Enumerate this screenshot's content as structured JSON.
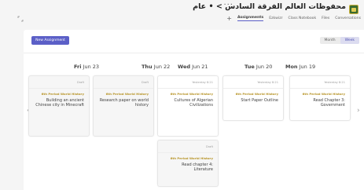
{
  "header": {
    "channel_title": "محفوظات العالم الفرقة السادس > • عام",
    "tabs": [
      {
        "label": "Conversations",
        "active": false
      },
      {
        "label": "Files",
        "active": false
      },
      {
        "label": "Class Notebook",
        "active": false
      },
      {
        "label": "Ezkwizr",
        "active": false
      },
      {
        "label": "Assignments",
        "active": true
      }
    ],
    "add_tab": "+",
    "more": "···"
  },
  "toolbar": {
    "new_assignment_label": "New Assignment",
    "view_toggle": [
      {
        "label": "Week",
        "active": true
      },
      {
        "label": "Month",
        "active": false
      }
    ]
  },
  "days": [
    {
      "day": "Mon",
      "date": "Jun 19"
    },
    {
      "day": "Tue",
      "date": "Jun 20"
    },
    {
      "day": "Wed",
      "date": "Jun 21"
    },
    {
      "day": "Thu",
      "date": "Jun 22"
    },
    {
      "day": "Fri",
      "date": "Jun 23"
    }
  ],
  "cards": [
    {
      "due": "Yesterday 8:21",
      "class": "6th Period World History",
      "title": "Read Chapter 3: Government"
    },
    {
      "due": "Yesterday 8:21",
      "class": "6th Period World History",
      "title": "Start Paper Outline"
    },
    {
      "due": "Yesterday 8:21",
      "class": "6th Period World History",
      "title": "Cultures of Algerian Civilizations"
    },
    {
      "due": "Draft",
      "class": "6th Period World History",
      "title": "Research paper on world history"
    },
    {
      "due": "Draft",
      "class": "6th Period World History",
      "title": "Building an ancient Chinese city in Minecraft"
    },
    {
      "due": "Draft",
      "class": "6th Period World History",
      "title": "Read chapter 4: Literature"
    }
  ],
  "colors": {
    "accent": "#5b5fc7",
    "class_label": "#b8952a",
    "background": "#f5f5f5"
  }
}
